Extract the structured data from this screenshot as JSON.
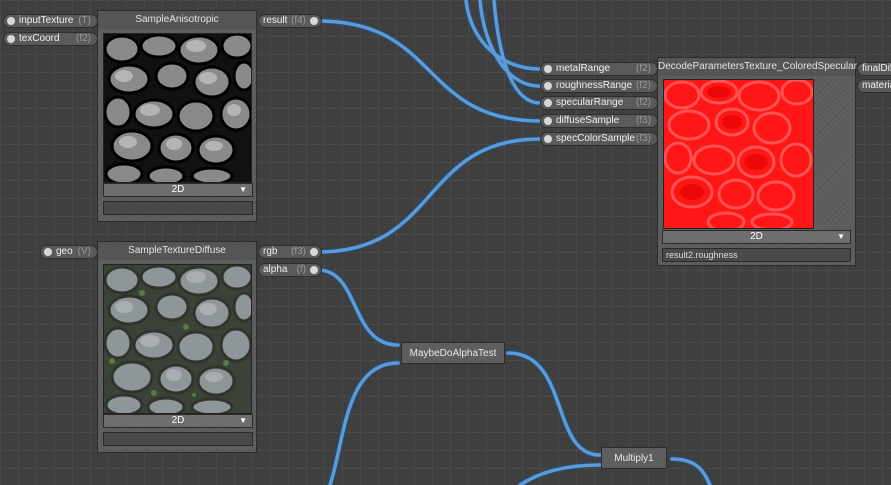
{
  "colors": {
    "wire": "#4f8fd0",
    "canvas": "#3f3f3f"
  },
  "nodes": {
    "sample_aniso": {
      "title": "SampleAnisotropic",
      "inputs": [
        {
          "name": "inputTexture",
          "type": "(T)"
        },
        {
          "name": "texCoord",
          "type": "(f2)"
        }
      ],
      "output": {
        "name": "result",
        "type": "(f4)"
      },
      "mode": "2D"
    },
    "sample_diffuse": {
      "title": "SampleTextureDiffuse",
      "input": {
        "name": "geo",
        "type": "(V)"
      },
      "outputs": [
        {
          "name": "rgb",
          "type": "(f3)"
        },
        {
          "name": "alpha",
          "type": "(f)"
        }
      ],
      "mode": "2D"
    },
    "decode": {
      "title": "DecodeParametersTexture_ColoredSpecular",
      "inputs": [
        {
          "name": "metalRange",
          "type": "(f2)"
        },
        {
          "name": "roughnessRange",
          "type": "(f2)"
        },
        {
          "name": "specularRange",
          "type": "(f2)"
        },
        {
          "name": "diffuseSample",
          "type": "(f3)"
        },
        {
          "name": "specColorSample",
          "type": "(f3)"
        }
      ],
      "outputs": [
        "finalDiff",
        "materia"
      ],
      "mode": "2D",
      "preview_field": "result2.roughness"
    },
    "alpha_test": {
      "title": "MaybeDoAlphaTest"
    },
    "multiply": {
      "title": "Multiply1"
    }
  }
}
